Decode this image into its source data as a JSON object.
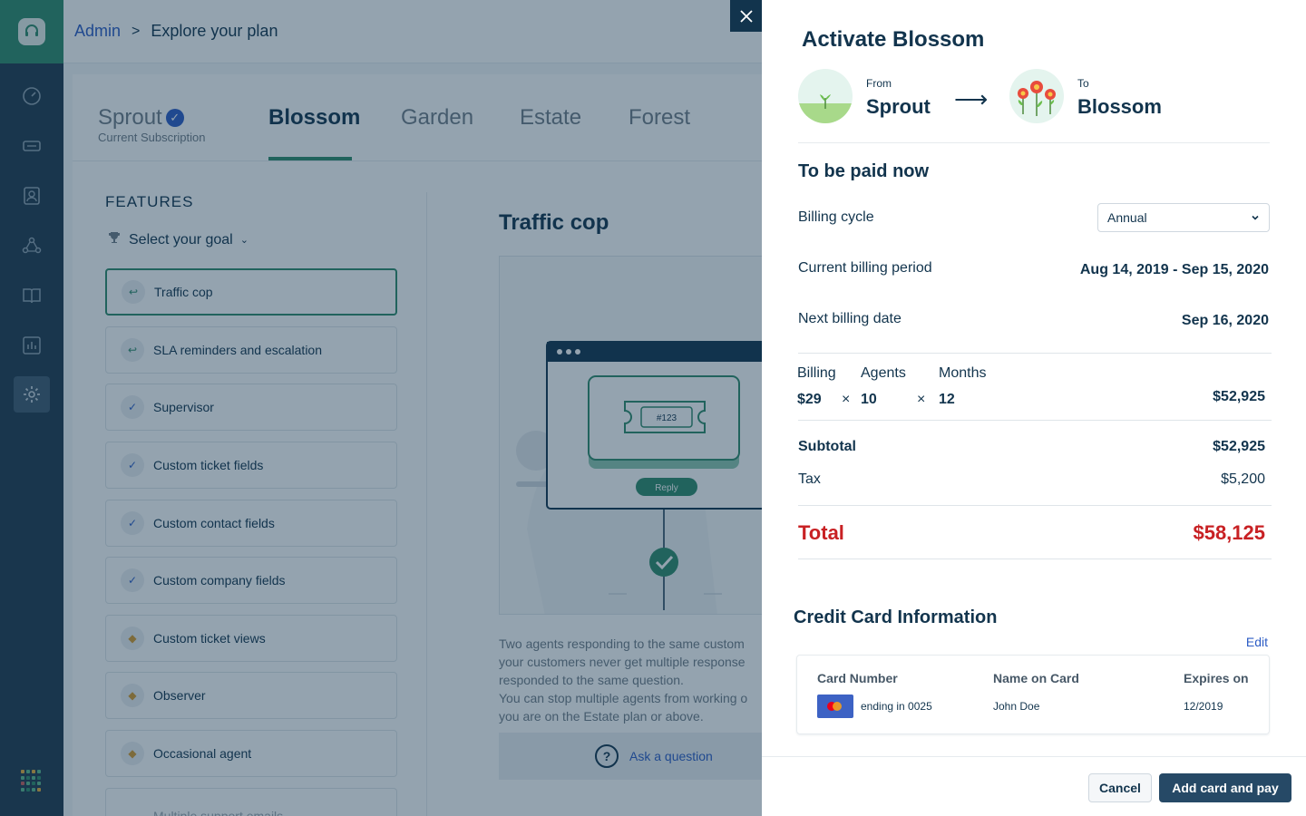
{
  "breadcrumb": {
    "parent": "Admin",
    "separator": ">",
    "current": "Explore your plan"
  },
  "plans": {
    "current": {
      "name": "Sprout",
      "subtitle": "Current Subscription"
    },
    "tabs": [
      "Blossom",
      "Garden",
      "Estate",
      "Forest"
    ]
  },
  "features": {
    "title": "FEATURES",
    "goal_label": "Select your goal",
    "items": [
      "Traffic cop",
      "SLA reminders and escalation",
      "Supervisor",
      "Custom ticket fields",
      "Custom contact fields",
      "Custom company fields",
      "Custom ticket views",
      "Observer",
      "Occasional agent",
      "Multiple support emails"
    ]
  },
  "detail": {
    "title": "Traffic cop",
    "ticket_number": "#123",
    "reply_label": "Reply",
    "description_lines": [
      "Two agents responding to the same custom",
      "your customers never get multiple response",
      "responded to the same question.",
      "You can stop multiple agents from working o",
      "you are on the Estate plan or above."
    ],
    "ask_label": "Ask a question"
  },
  "drawer": {
    "title": "Activate Blossom",
    "from_label": "From",
    "from_plan": "Sprout",
    "to_label": "To",
    "to_plan": "Blossom",
    "section_title": "To be paid now",
    "billing_cycle_label": "Billing cycle",
    "billing_cycle_value": "Annual",
    "current_period_label": "Current billing period",
    "current_period_value": "Aug 14, 2019 - Sep 15, 2020",
    "next_date_label": "Next billing date",
    "next_date_value": "Sep 16, 2020",
    "calc": {
      "billing_label": "Billing",
      "billing_value": "$29",
      "agents_label": "Agents",
      "agents_value": "10",
      "months_label": "Months",
      "months_value": "12",
      "times": "×",
      "amount": "$52,925"
    },
    "subtotal_label": "Subtotal",
    "subtotal_value": "$52,925",
    "tax_label": "Tax",
    "tax_value": "$5,200",
    "total_label": "Total",
    "total_value": "$58,125",
    "cc": {
      "title": "Credit Card Information",
      "edit_label": "Edit",
      "number_header": "Card Number",
      "name_header": "Name on Card",
      "expires_header": "Expires on",
      "number_value": "ending in 0025",
      "name_value": "John Doe",
      "expires_value": "12/2019"
    },
    "cancel_label": "Cancel",
    "primary_label": "Add card and pay"
  },
  "colors": {
    "accent_green": "#2f8a6b",
    "nav_bg": "#1f3a4e",
    "link_blue": "#2c5cc5",
    "total_red": "#c82124",
    "primary_btn": "#264966"
  },
  "icons": {
    "nav": [
      "dashboard-icon",
      "tickets-icon",
      "contacts-icon",
      "groups-icon",
      "solutions-icon",
      "reports-icon",
      "admin-gear-icon"
    ],
    "close": "close-icon",
    "apps": "apps-grid-icon"
  }
}
